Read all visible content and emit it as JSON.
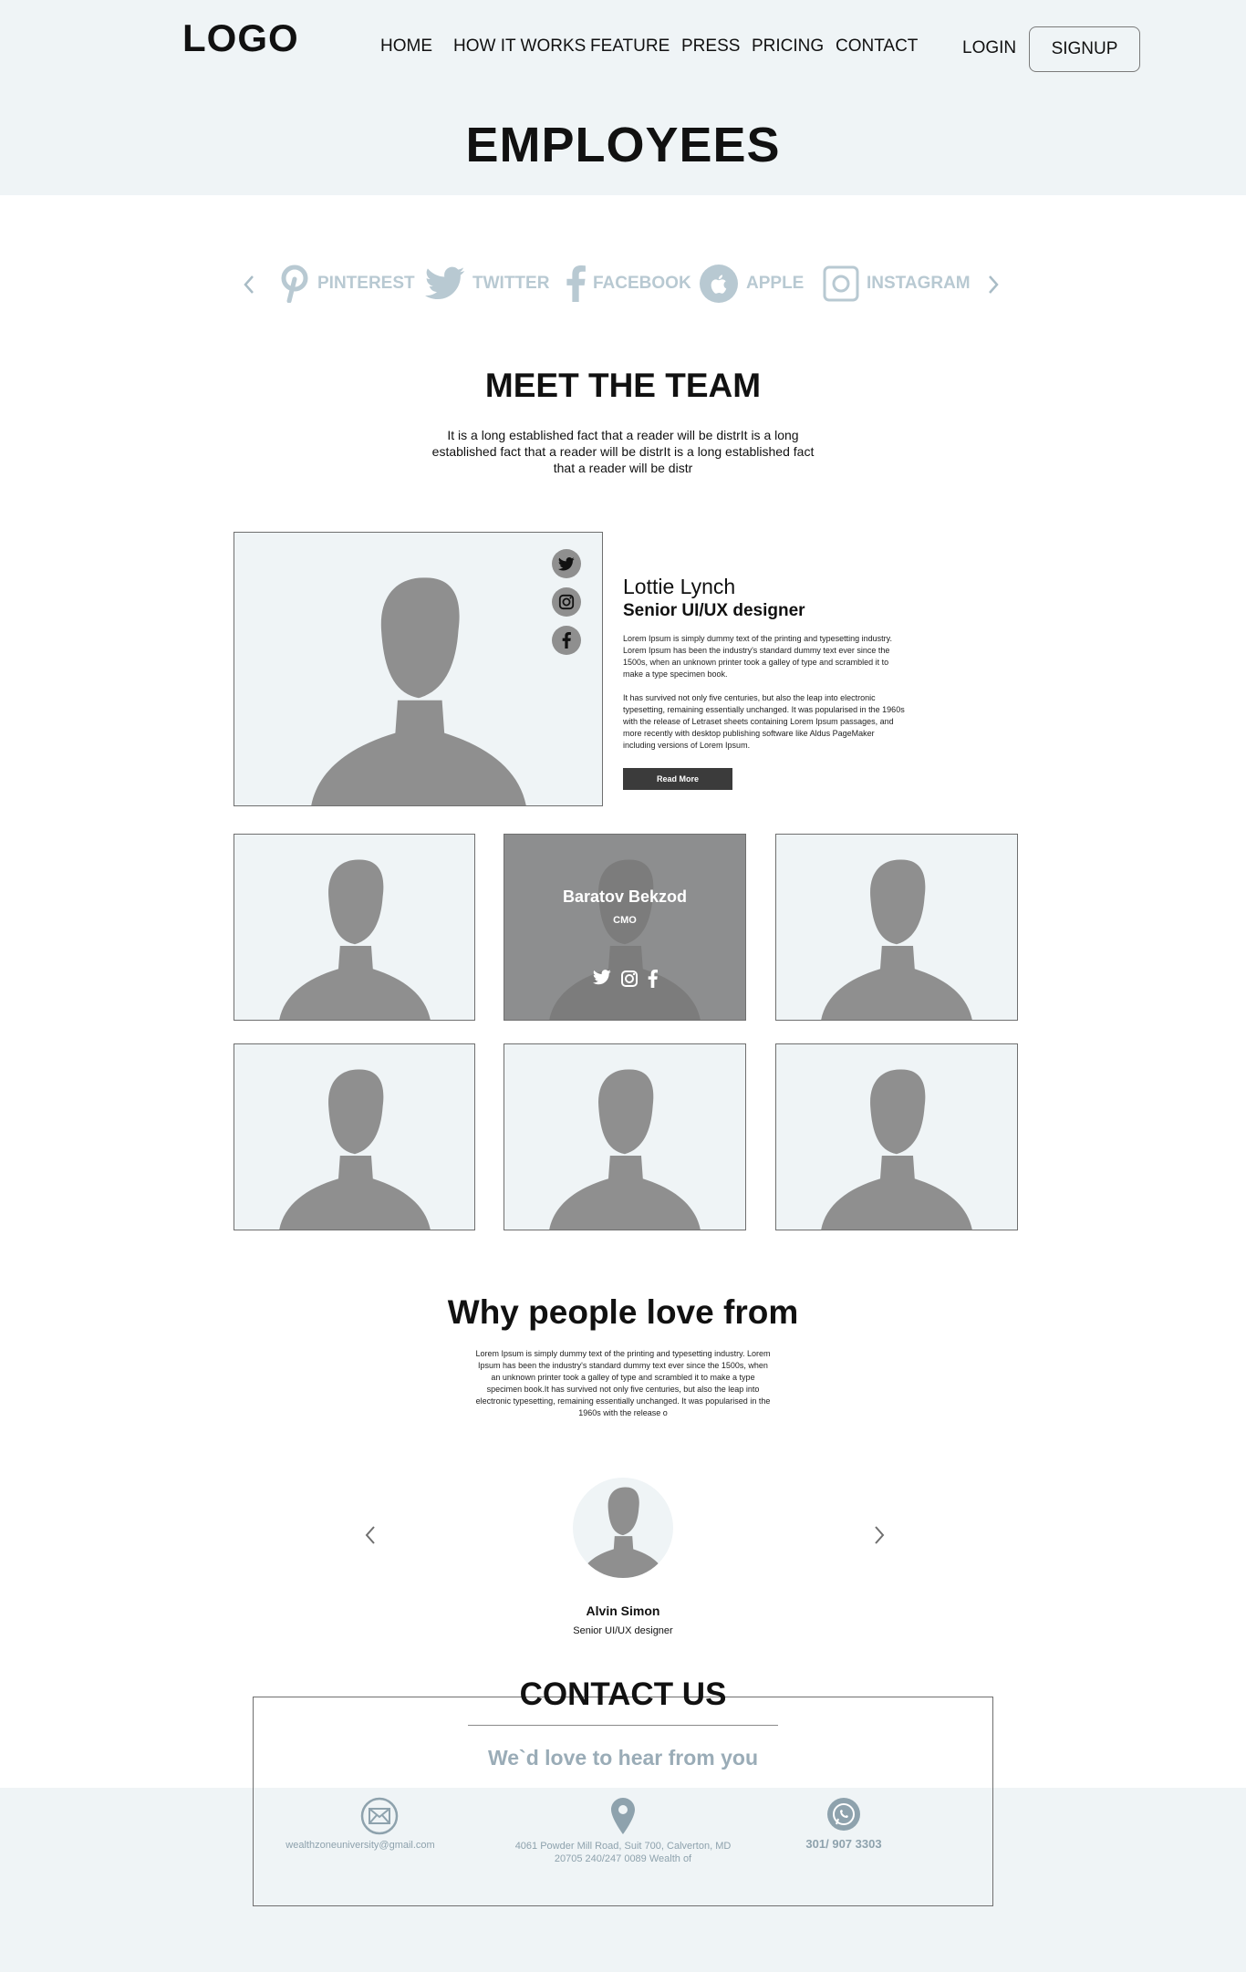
{
  "header": {
    "logo": "LOGO",
    "nav": [
      "HOME",
      "HOW IT WORKS",
      "FEATURE",
      "PRESS",
      "PRICING",
      "CONTACT"
    ],
    "login": "LOGIN",
    "signup": "SIGNUP"
  },
  "page_title": "EMPLOYEES",
  "brands": {
    "items": [
      {
        "label": "PINTEREST",
        "icon": "pinterest-icon"
      },
      {
        "label": "TWITTER",
        "icon": "twitter-icon"
      },
      {
        "label": "FACEBOOK",
        "icon": "facebook-icon"
      },
      {
        "label": "APPLE",
        "icon": "apple-icon"
      },
      {
        "label": "INSTAGRAM",
        "icon": "instagram-icon"
      }
    ],
    "color": "#b8c9d2"
  },
  "team": {
    "title": "MEET THE TEAM",
    "lead": "It is a long established fact that a reader will be distrIt is a long established fact that a reader will be distrIt is a long established fact that a reader will be distr",
    "featured": {
      "name": "Lottie Lynch",
      "role": "Senior UI/UX designer",
      "p1": "Lorem Ipsum is simply dummy text of the printing and typesetting industry. Lorem Ipsum has been the industry's standard dummy text ever since the 1500s, when an unknown printer took a galley of type and scrambled it to make a type specimen book.",
      "p2": " It has survived not only five centuries, but also the leap into electronic typesetting, remaining essentially unchanged. It was popularised in the 1960s with the release of Letraset sheets containing Lorem Ipsum passages, and more recently with desktop publishing software like Aldus PageMaker including versions of Lorem Ipsum.",
      "button": "Read More",
      "social_icons": [
        "twitter-icon",
        "instagram-icon",
        "facebook-icon"
      ]
    },
    "hover_card": {
      "name": "Baratov Bekzod",
      "role": "CMO"
    }
  },
  "why": {
    "title": "Why people love from",
    "text": "Lorem Ipsum is simply dummy text of the printing and typesetting industry. Lorem Ipsum has been the industry's standard dummy text ever since the 1500s, when an unknown printer took a galley of type and scrambled it to make a type specimen book.It has survived not only five centuries, but also the leap into electronic typesetting, remaining essentially unchanged. It was popularised in the 1960s with the release o",
    "testimonial": {
      "name": "Alvin Simon",
      "role": "Senior UI/UX designer"
    }
  },
  "contact": {
    "title": "CONTACT US",
    "subtitle": "We`d love to hear from you",
    "email": "wealthzoneuniversity@gmail.com",
    "address": "4061 Powder Mill Road, Suit 700, Calverton, MD 20705 240/247 0089 Wealth of",
    "phone": "301/ 907 3303",
    "accent": "#8ea2ad"
  },
  "colors": {
    "band": "#eff4f6",
    "placeholder_silhouette": "#8f8f8f",
    "dark_button": "#3b3b3b"
  }
}
